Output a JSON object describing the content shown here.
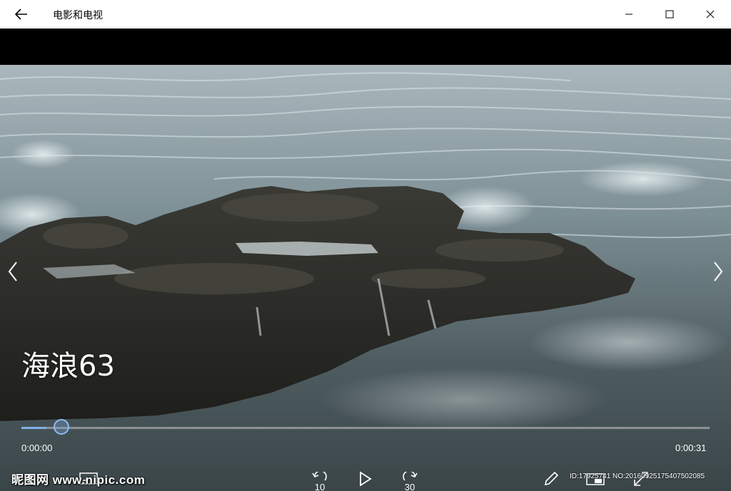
{
  "titlebar": {
    "title": "电影和电视",
    "back_icon": "back-arrow-icon",
    "minimize_icon": "minimize-icon",
    "maximize_icon": "maximize-icon",
    "close_icon": "close-icon"
  },
  "video": {
    "title": "海浪63",
    "position_fraction": 0.036,
    "elapsed": "0:00:00",
    "duration": "0:00:31"
  },
  "controls": {
    "rewind_label": "10",
    "forward_label": "30",
    "rewind_icon": "rewind-10-icon",
    "play_icon": "play-icon",
    "forward_icon": "forward-30-icon",
    "edit_icon": "pencil-icon",
    "mini_view_icon": "mini-view-icon",
    "fullscreen_icon": "fullscreen-icon",
    "subtitles_icon": "subtitles-icon"
  },
  "watermark": {
    "text": "昵图网 www.nipic.com",
    "id_text": "ID:17925741 NO:20160925175407502085"
  },
  "colors": {
    "accent": "#7fb0e8",
    "titlebar_bg": "#ffffff"
  }
}
